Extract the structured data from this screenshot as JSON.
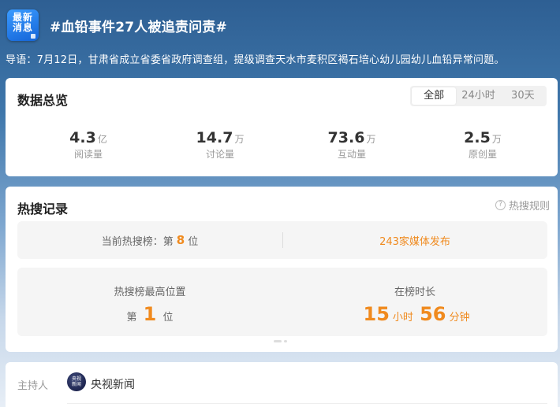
{
  "header": {
    "badge_line1": "最新",
    "badge_line2": "消息",
    "title": "#血铅事件27人被追责问责#",
    "lead": "导语：7月12日，甘肃省成立省委省政府调查组，提级调查天水市麦积区褐石培心幼儿园幼儿血铅异常问题。"
  },
  "overview": {
    "title": "数据总览",
    "filters": [
      {
        "label": "全部",
        "active": true
      },
      {
        "label": "24小时",
        "active": false
      },
      {
        "label": "30天",
        "active": false
      }
    ],
    "stats": [
      {
        "value": "4.3",
        "unit": "亿",
        "label": "阅读量"
      },
      {
        "value": "14.7",
        "unit": "万",
        "label": "讨论量"
      },
      {
        "value": "73.6",
        "unit": "万",
        "label": "互动量"
      },
      {
        "value": "2.5",
        "unit": "万",
        "label": "原创量"
      }
    ]
  },
  "hot": {
    "title": "热搜记录",
    "rules_label": "热搜规则",
    "rules_icon": "question-icon",
    "current_rank_prefix": "当前热搜榜：第",
    "current_rank_value": "8",
    "current_rank_suffix": "位",
    "media": "243家媒体发布",
    "peak_title": "热搜榜最高位置",
    "peak_prefix": "第",
    "peak_value": "1",
    "peak_suffix": "位",
    "duration_title": "在榜时长",
    "duration_hours": "15",
    "duration_hours_unit": "小时",
    "duration_minutes": "56",
    "duration_minutes_unit": "分钟",
    "accent_color": "#f08a1e"
  },
  "host": {
    "label": "主持人",
    "avatar_line1": "央视",
    "avatar_line2": "新闻",
    "name": "央视新闻"
  }
}
